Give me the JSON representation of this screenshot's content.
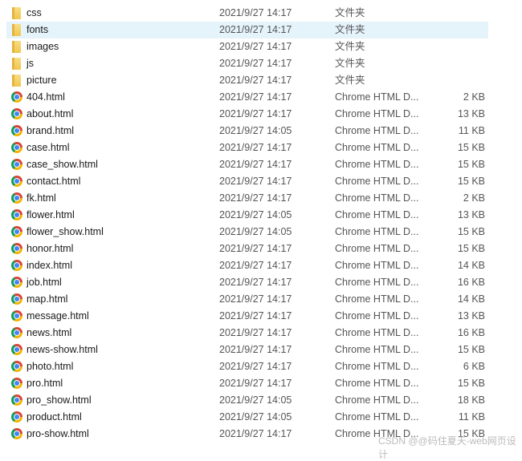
{
  "files": [
    {
      "name": "css",
      "date": "2021/9/27 14:17",
      "type": "文件夹",
      "size": "",
      "icon": "folder"
    },
    {
      "name": "fonts",
      "date": "2021/9/27 14:17",
      "type": "文件夹",
      "size": "",
      "icon": "folder",
      "selected": true
    },
    {
      "name": "images",
      "date": "2021/9/27 14:17",
      "type": "文件夹",
      "size": "",
      "icon": "folder"
    },
    {
      "name": "js",
      "date": "2021/9/27 14:17",
      "type": "文件夹",
      "size": "",
      "icon": "folder"
    },
    {
      "name": "picture",
      "date": "2021/9/27 14:17",
      "type": "文件夹",
      "size": "",
      "icon": "folder"
    },
    {
      "name": "404.html",
      "date": "2021/9/27 14:17",
      "type": "Chrome HTML D...",
      "size": "2 KB",
      "icon": "chrome"
    },
    {
      "name": "about.html",
      "date": "2021/9/27 14:17",
      "type": "Chrome HTML D...",
      "size": "13 KB",
      "icon": "chrome"
    },
    {
      "name": "brand.html",
      "date": "2021/9/27 14:05",
      "type": "Chrome HTML D...",
      "size": "11 KB",
      "icon": "chrome"
    },
    {
      "name": "case.html",
      "date": "2021/9/27 14:17",
      "type": "Chrome HTML D...",
      "size": "15 KB",
      "icon": "chrome"
    },
    {
      "name": "case_show.html",
      "date": "2021/9/27 14:17",
      "type": "Chrome HTML D...",
      "size": "15 KB",
      "icon": "chrome"
    },
    {
      "name": "contact.html",
      "date": "2021/9/27 14:17",
      "type": "Chrome HTML D...",
      "size": "15 KB",
      "icon": "chrome"
    },
    {
      "name": "fk.html",
      "date": "2021/9/27 14:17",
      "type": "Chrome HTML D...",
      "size": "2 KB",
      "icon": "chrome"
    },
    {
      "name": "flower.html",
      "date": "2021/9/27 14:05",
      "type": "Chrome HTML D...",
      "size": "13 KB",
      "icon": "chrome"
    },
    {
      "name": "flower_show.html",
      "date": "2021/9/27 14:05",
      "type": "Chrome HTML D...",
      "size": "15 KB",
      "icon": "chrome"
    },
    {
      "name": "honor.html",
      "date": "2021/9/27 14:17",
      "type": "Chrome HTML D...",
      "size": "15 KB",
      "icon": "chrome"
    },
    {
      "name": "index.html",
      "date": "2021/9/27 14:17",
      "type": "Chrome HTML D...",
      "size": "14 KB",
      "icon": "chrome"
    },
    {
      "name": "job.html",
      "date": "2021/9/27 14:17",
      "type": "Chrome HTML D...",
      "size": "16 KB",
      "icon": "chrome"
    },
    {
      "name": "map.html",
      "date": "2021/9/27 14:17",
      "type": "Chrome HTML D...",
      "size": "14 KB",
      "icon": "chrome"
    },
    {
      "name": "message.html",
      "date": "2021/9/27 14:17",
      "type": "Chrome HTML D...",
      "size": "13 KB",
      "icon": "chrome"
    },
    {
      "name": "news.html",
      "date": "2021/9/27 14:17",
      "type": "Chrome HTML D...",
      "size": "16 KB",
      "icon": "chrome"
    },
    {
      "name": "news-show.html",
      "date": "2021/9/27 14:17",
      "type": "Chrome HTML D...",
      "size": "15 KB",
      "icon": "chrome"
    },
    {
      "name": "photo.html",
      "date": "2021/9/27 14:17",
      "type": "Chrome HTML D...",
      "size": "6 KB",
      "icon": "chrome"
    },
    {
      "name": "pro.html",
      "date": "2021/9/27 14:17",
      "type": "Chrome HTML D...",
      "size": "15 KB",
      "icon": "chrome"
    },
    {
      "name": "pro_show.html",
      "date": "2021/9/27 14:05",
      "type": "Chrome HTML D...",
      "size": "18 KB",
      "icon": "chrome"
    },
    {
      "name": "product.html",
      "date": "2021/9/27 14:05",
      "type": "Chrome HTML D...",
      "size": "11 KB",
      "icon": "chrome"
    },
    {
      "name": "pro-show.html",
      "date": "2021/9/27 14:17",
      "type": "Chrome HTML D...",
      "size": "15 KB",
      "icon": "chrome"
    }
  ],
  "watermark": "CSDN @@码住夏天-web网页设计",
  "colors": {
    "selection": "#e5f3fb",
    "folder": "#f0c64e"
  }
}
